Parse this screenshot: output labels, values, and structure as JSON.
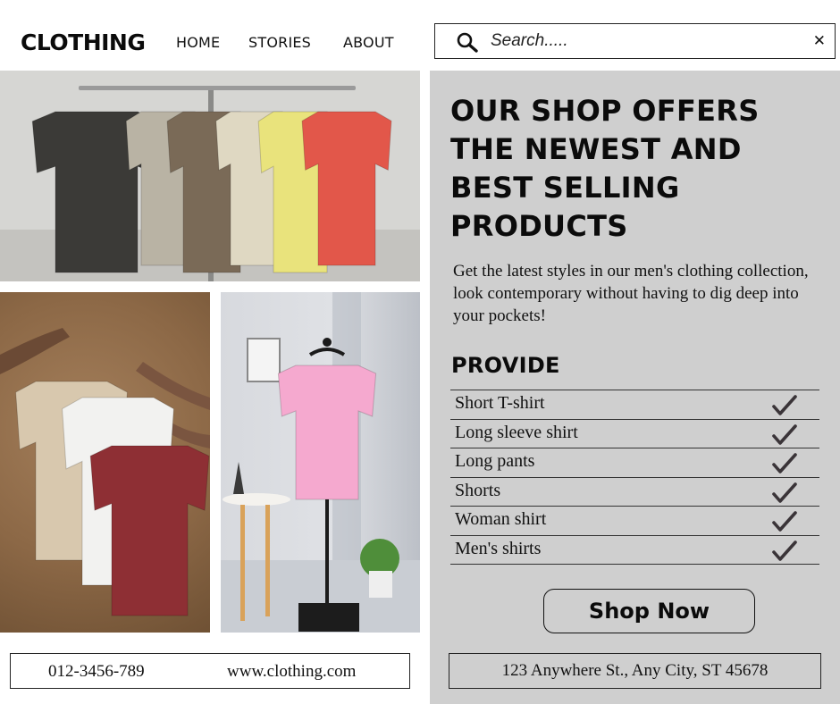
{
  "header": {
    "logo": "CLOTHING",
    "nav": [
      "HOME",
      "STORIES",
      "ABOUT"
    ],
    "search": {
      "placeholder": "Search....."
    }
  },
  "photos": [
    {
      "name": "t-shirt-rack-photo",
      "shirt_colors": [
        "#3b3a37",
        "#b9b3a4",
        "#7a6a57",
        "#dfd8c2",
        "#e9e37c",
        "#e2574a"
      ]
    },
    {
      "name": "hangers-hands-photo",
      "shirt_colors": [
        "#d8c8ae",
        "#f2f2f0",
        "#8e2f34"
      ]
    },
    {
      "name": "pink-shirt-stand-photo",
      "shirt_colors": [
        "#f5a9cf"
      ]
    }
  ],
  "contact": {
    "phone": "012-3456-789",
    "website": "www.clothing.com"
  },
  "panel": {
    "headline": "OUR SHOP OFFERS THE NEWEST AND BEST SELLING PRODUCTS",
    "description": "Get the latest styles in our men's clothing collection, look contemporary without having to dig deep into your pockets!",
    "provide_title": "PROVIDE",
    "items": [
      {
        "label": "Short T-shirt"
      },
      {
        "label": "Long sleeve shirt"
      },
      {
        "label": "Long pants"
      },
      {
        "label": "Shorts"
      },
      {
        "label": "Woman shirt"
      },
      {
        "label": "Men's shirts"
      }
    ],
    "cta": "Shop Now",
    "address": "123 Anywhere St., Any City, ST 45678"
  },
  "colors": {
    "panel_bg": "#cfcfcf",
    "text": "#111111",
    "check": "#3a3438"
  }
}
